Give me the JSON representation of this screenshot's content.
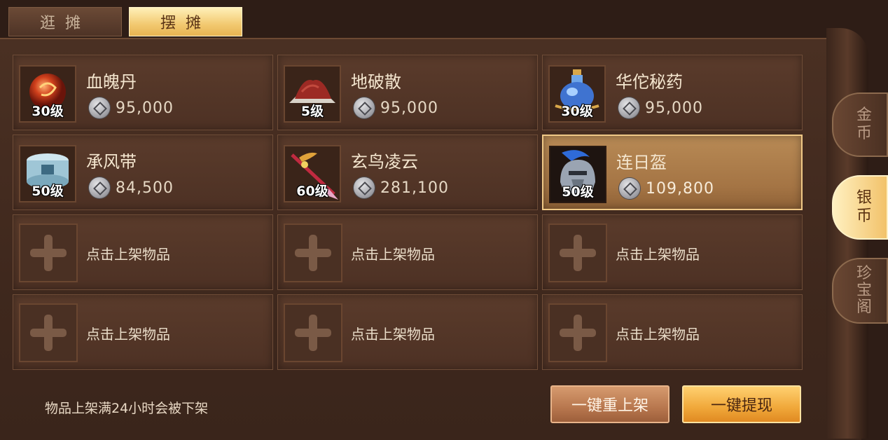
{
  "tabs": {
    "browse": "逛摊",
    "stall": "摆摊"
  },
  "items": [
    {
      "name": "血魄丹",
      "level": "30级",
      "price": "95,000",
      "icon": "red-orb-icon"
    },
    {
      "name": "地破散",
      "level": "5级",
      "price": "95,000",
      "icon": "powder-pile-icon"
    },
    {
      "name": "华佗秘药",
      "level": "30级",
      "price": "95,000",
      "icon": "potion-bottle-icon"
    },
    {
      "name": "承风带",
      "level": "50级",
      "price": "84,500",
      "icon": "belt-icon"
    },
    {
      "name": "玄鸟凌云",
      "level": "60级",
      "price": "281,100",
      "icon": "spear-icon"
    },
    {
      "name": "连日盔",
      "level": "50级",
      "price": "109,800",
      "icon": "helmet-icon"
    }
  ],
  "empty_slots": [
    "点击上架物品",
    "点击上架物品",
    "点击上架物品",
    "点击上架物品",
    "点击上架物品",
    "点击上架物品"
  ],
  "side_tabs": {
    "gold": "金币",
    "silver": "银币",
    "treasure": "珍宝阁"
  },
  "footer": {
    "note": "物品上架满24小时会被下架",
    "relist": "一键重上架",
    "withdraw": "一键提现"
  },
  "colors": {
    "accent_gold": "#f2c970",
    "panel": "#4d3124",
    "selected": "#a47444"
  }
}
